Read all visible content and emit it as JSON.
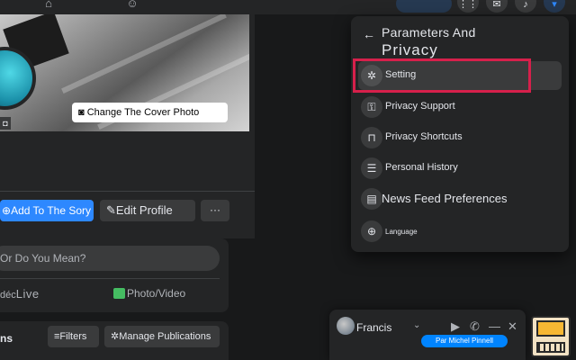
{
  "topnav": {
    "home_icon": "home-icon",
    "groups_icon": "groups-icon",
    "menu_icon": "grid-menu-icon",
    "messenger_icon": "messenger-icon",
    "notifications_icon": "bell-icon",
    "account_icon": "caret-down-icon"
  },
  "profile": {
    "change_cover_label": "Change The Cover Photo",
    "add_story_label": "Add To The Sory",
    "edit_profile_label": "Edit Profile",
    "more_label": "···"
  },
  "post_box": {
    "prompt": "Or Do You Mean?",
    "live_prefix": "déc",
    "live_label": "Live",
    "photo_label": "Photo/Video"
  },
  "publications": {
    "title": "ns",
    "filters_label": "Filters",
    "manage_label": "Manage Publications"
  },
  "dropdown": {
    "title_line1": "Parameters And",
    "title_line2": "Privacy",
    "items": [
      {
        "label": "Setting",
        "icon": "gear-icon",
        "selected": true
      },
      {
        "label": "Privacy Support",
        "icon": "lock-question-icon",
        "selected": false
      },
      {
        "label": "Privacy Shortcuts",
        "icon": "lock-icon",
        "selected": false
      },
      {
        "label": "Personal History",
        "icon": "list-icon",
        "selected": false
      },
      {
        "label": "News Feed Preferences",
        "icon": "news-feed-icon",
        "selected": false
      },
      {
        "label": "Language",
        "icon": "globe-icon",
        "selected": false
      }
    ]
  },
  "chat": {
    "name": "Francis",
    "message": "Par Michel Pinnell",
    "icons": [
      "video-icon",
      "phone-icon",
      "minimize-icon",
      "close-icon"
    ]
  },
  "colors": {
    "background": "#18191a",
    "surface": "#242526",
    "button": "#3a3b3c",
    "accent": "#2d88ff",
    "highlight": "#d6204b"
  }
}
